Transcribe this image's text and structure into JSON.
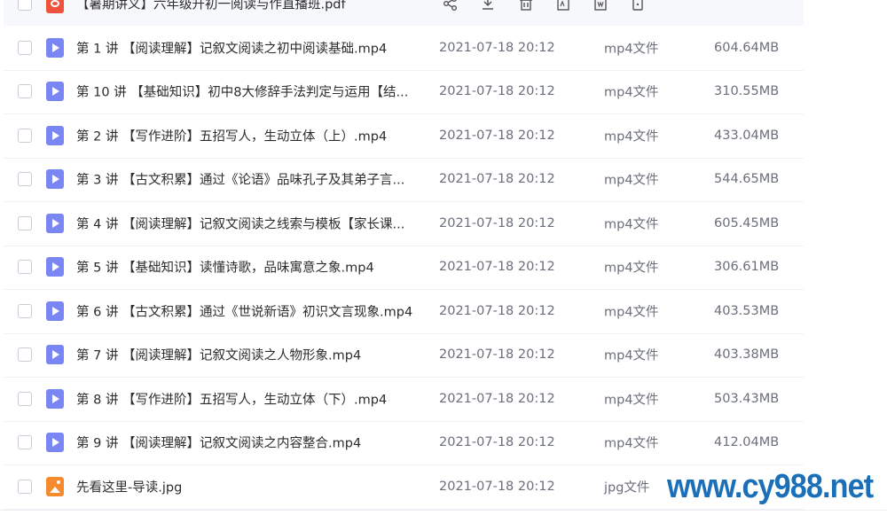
{
  "file_list": {
    "top_row": {
      "name": "【暑期讲义】六年级升初一阅读与作直播班.pdf",
      "icon": "pdf-icon",
      "actions": [
        "share-icon",
        "download-icon",
        "delete-icon",
        "rename-icon",
        "copy-icon",
        "more-icon"
      ]
    },
    "rows": [
      {
        "name": "第 1 讲 【阅读理解】记叙文阅读之初中阅读基础.mp4",
        "date": "2021-07-18 20:12",
        "type": "mp4文件",
        "size": "604.64MB",
        "icon": "video-file-icon"
      },
      {
        "name": "第 10 讲 【基础知识】初中8大修辞手法判定与运用【结...",
        "date": "2021-07-18 20:12",
        "type": "mp4文件",
        "size": "310.55MB",
        "icon": "video-file-icon"
      },
      {
        "name": "第 2 讲 【写作进阶】五招写人，生动立体（上）.mp4",
        "date": "2021-07-18 20:12",
        "type": "mp4文件",
        "size": "433.04MB",
        "icon": "video-file-icon"
      },
      {
        "name": "第 3 讲 【古文积累】通过《论语》品味孔子及其弟子言...",
        "date": "2021-07-18 20:12",
        "type": "mp4文件",
        "size": "544.65MB",
        "icon": "video-file-icon"
      },
      {
        "name": "第 4 讲 【阅读理解】记叙文阅读之线索与模板【家长课...",
        "date": "2021-07-18 20:12",
        "type": "mp4文件",
        "size": "605.45MB",
        "icon": "video-file-icon"
      },
      {
        "name": "第 5 讲 【基础知识】读懂诗歌，品味寓意之象.mp4",
        "date": "2021-07-18 20:12",
        "type": "mp4文件",
        "size": "306.61MB",
        "icon": "video-file-icon"
      },
      {
        "name": "第 6 讲 【古文积累】通过《世说新语》初识文言现象.mp4",
        "date": "2021-07-18 20:12",
        "type": "mp4文件",
        "size": "403.53MB",
        "icon": "video-file-icon"
      },
      {
        "name": "第 7 讲 【阅读理解】记叙文阅读之人物形象.mp4",
        "date": "2021-07-18 20:12",
        "type": "mp4文件",
        "size": "403.38MB",
        "icon": "video-file-icon"
      },
      {
        "name": "第 8 讲 【写作进阶】五招写人，生动立体（下）.mp4",
        "date": "2021-07-18 20:12",
        "type": "mp4文件",
        "size": "503.43MB",
        "icon": "video-file-icon"
      },
      {
        "name": "第 9 讲 【阅读理解】记叙文阅读之内容整合.mp4",
        "date": "2021-07-18 20:12",
        "type": "mp4文件",
        "size": "412.04MB",
        "icon": "video-file-icon"
      },
      {
        "name": "先看这里-导读.jpg",
        "date": "2021-07-18 20:12",
        "type": "jpg文件",
        "size": "",
        "icon": "image-file-icon"
      }
    ]
  },
  "watermark": {
    "text": "www.cy988.net",
    "color": "#1a6fb8"
  },
  "colors": {
    "video_icon": "#7b86f5",
    "pdf_icon": "#f0533c",
    "image_icon": "#f58a2e"
  }
}
